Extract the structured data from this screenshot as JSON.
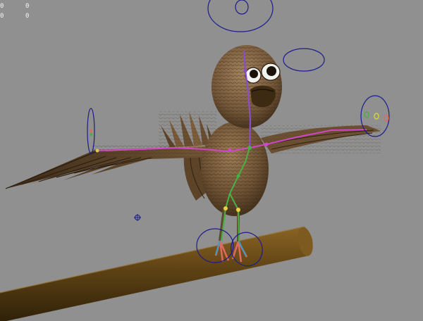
{
  "hud": {
    "row1_left": "0",
    "row1_right": "0",
    "row2_left": "0",
    "row2_right": "0"
  },
  "colors": {
    "viewport_bg": "#909090",
    "control_curve": "#1c1c8c",
    "branch": "#5b3f12",
    "feather": "#6b5031",
    "spine_bone": "#8a4fc8",
    "leg_bone": "#46b246"
  },
  "objects": {
    "scene": "3d-viewport-scene",
    "character": "bird-rig",
    "prop": "branch"
  }
}
